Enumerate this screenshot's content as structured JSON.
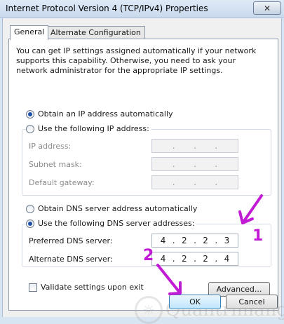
{
  "window": {
    "title": "Internet Protocol Version 4 (TCP/IPv4) Properties",
    "close_glyph": "✕"
  },
  "tabs": [
    {
      "label": "General",
      "active": true
    },
    {
      "label": "Alternate Configuration",
      "active": false
    }
  ],
  "info_text": "You can get IP settings assigned automatically if your network supports this capability. Otherwise, you need to ask your network administrator for the appropriate IP settings.",
  "ip": {
    "obtain_auto_label": "Obtain an IP address automatically",
    "obtain_auto_selected": true,
    "use_following_label": "Use the following IP address:",
    "use_following_selected": false,
    "fields": [
      {
        "label": "IP address:",
        "dots": ".  .  ."
      },
      {
        "label": "Subnet mask:",
        "dots": ".  .  ."
      },
      {
        "label": "Default gateway:",
        "dots": ".  .  ."
      }
    ]
  },
  "dns": {
    "obtain_auto_label": "Obtain DNS server address automatically",
    "obtain_auto_selected": false,
    "use_following_label": "Use the following DNS server addresses:",
    "use_following_selected": true,
    "preferred": {
      "label": "Preferred DNS server:",
      "octets": [
        "4",
        "2",
        "2",
        "3"
      ]
    },
    "alternate": {
      "label": "Alternate DNS server:",
      "octets": [
        "4",
        "2",
        "2",
        "4"
      ]
    }
  },
  "validate": {
    "label": "Validate settings upon exit",
    "checked": false
  },
  "buttons": {
    "advanced": "Advanced...",
    "ok": "OK",
    "cancel": "Cancel"
  },
  "annotations": {
    "one": "1",
    "two": "2",
    "color": "#c21bd6"
  },
  "watermark": {
    "text": "Quantrimang"
  }
}
